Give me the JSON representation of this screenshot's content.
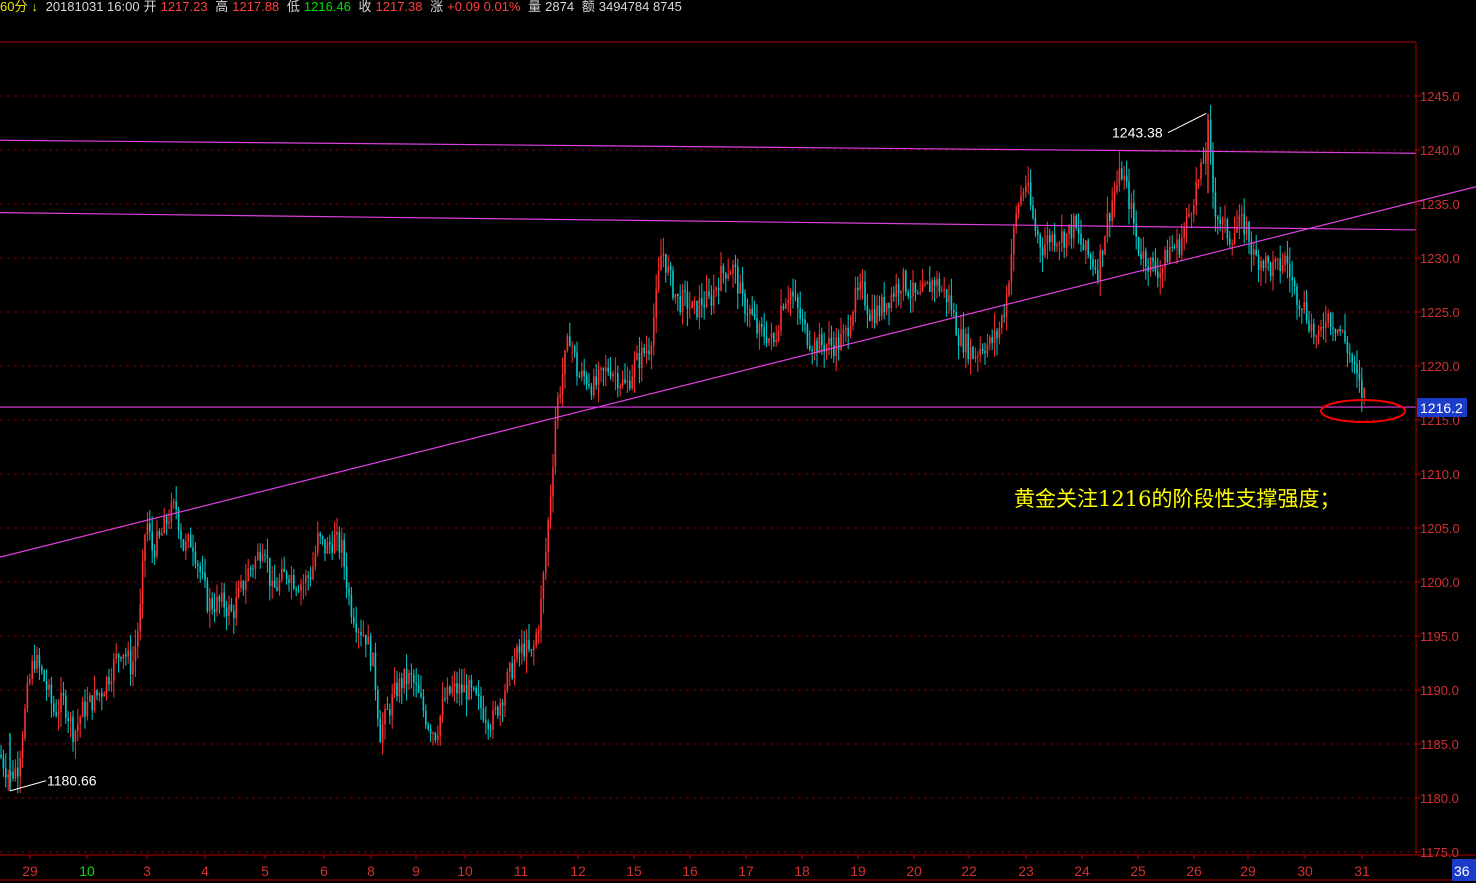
{
  "header": {
    "period": "60分",
    "arrow": "↓",
    "date_time": "20181031 16:00",
    "open_label": "开",
    "open": "1217.23",
    "high_label": "高",
    "high": "1217.88",
    "low_label": "低",
    "low": "1216.46",
    "close_label": "收",
    "close": "1217.38",
    "change_label": "涨",
    "change": "+0.09 0.01%",
    "volume_label": "量",
    "volume": "2874",
    "amount_label": "额",
    "amount": "3494784 8745"
  },
  "colors": {
    "background": "#000000",
    "up": "#ff3030",
    "down": "#00cccc",
    "frame": "#b00000",
    "grid": "#7a0000",
    "trendline": "#e040e0",
    "annotation": "#ffff00",
    "price_tag_bg": "#1a3cc8",
    "highlight_circle": "#ff0000"
  },
  "chart_data": {
    "type": "candlestick",
    "ylim": [
      1175,
      1247
    ],
    "y_ticks": [
      "1245.0",
      "1240.0",
      "1235.0",
      "1230.0",
      "1225.0",
      "1220.0",
      "1215.0",
      "1210.0",
      "1205.0",
      "1200.0",
      "1195.0",
      "1190.0",
      "1185.0",
      "1180.0",
      "1175.0"
    ],
    "x_tick_labels": [
      "29",
      "10",
      "3",
      "4",
      "5",
      "6",
      "8",
      "9",
      "10",
      "11",
      "12",
      "15",
      "16",
      "17",
      "18",
      "19",
      "20",
      "22",
      "23",
      "24",
      "25",
      "26",
      "29",
      "30",
      "31"
    ],
    "x_tick_colors": [
      "red",
      "green",
      "red",
      "red",
      "red",
      "red",
      "red",
      "red",
      "red",
      "red",
      "red",
      "red",
      "red",
      "red",
      "red",
      "red",
      "red",
      "red",
      "red",
      "red",
      "red",
      "red",
      "red",
      "red",
      "red"
    ],
    "x_corner_label": "36",
    "current_price": "1216.2",
    "max_label": "1243.38",
    "min_label": "1180.66",
    "annotation": "黄金关注1216的阶段性支撑强度；",
    "max_value": 1243.38,
    "min_value": 1180.66,
    "support_value": 1216.2,
    "lines": [
      {
        "name": "upper-resistance-line",
        "from": [
          0,
          1240.9
        ],
        "to": [
          1416,
          1239.7
        ]
      },
      {
        "name": "middle-resistance-line",
        "from": [
          0,
          1234.2
        ],
        "to": [
          1416,
          1232.6
        ]
      },
      {
        "name": "rising-trendline",
        "from": [
          0,
          1202.3
        ],
        "to": [
          1476,
          1236.6
        ]
      },
      {
        "name": "support-line",
        "from": [
          0,
          1216.2
        ],
        "to": [
          1416,
          1216.2
        ]
      }
    ],
    "anchors": [
      [
        0,
        1184
      ],
      [
        10,
        1182
      ],
      [
        18,
        1183
      ],
      [
        28,
        1190
      ],
      [
        34,
        1193
      ],
      [
        44,
        1191
      ],
      [
        54,
        1188
      ],
      [
        64,
        1189
      ],
      [
        74,
        1186
      ],
      [
        82,
        1188
      ],
      [
        92,
        1189
      ],
      [
        102,
        1190
      ],
      [
        112,
        1192
      ],
      [
        122,
        1194
      ],
      [
        132,
        1192
      ],
      [
        140,
        1197
      ],
      [
        146,
        1206
      ],
      [
        152,
        1203
      ],
      [
        160,
        1204
      ],
      [
        168,
        1206
      ],
      [
        176,
        1207
      ],
      [
        184,
        1203
      ],
      [
        192,
        1204
      ],
      [
        200,
        1201
      ],
      [
        208,
        1198
      ],
      [
        216,
        1198
      ],
      [
        224,
        1198
      ],
      [
        232,
        1197
      ],
      [
        240,
        1199
      ],
      [
        248,
        1201
      ],
      [
        256,
        1202
      ],
      [
        264,
        1204
      ],
      [
        272,
        1199
      ],
      [
        280,
        1200
      ],
      [
        288,
        1201
      ],
      [
        296,
        1200
      ],
      [
        304,
        1200
      ],
      [
        312,
        1201
      ],
      [
        318,
        1204
      ],
      [
        326,
        1203
      ],
      [
        334,
        1204
      ],
      [
        342,
        1203
      ],
      [
        350,
        1198
      ],
      [
        358,
        1196
      ],
      [
        366,
        1195
      ],
      [
        374,
        1192
      ],
      [
        380,
        1186
      ],
      [
        388,
        1188
      ],
      [
        396,
        1190
      ],
      [
        404,
        1191
      ],
      [
        412,
        1191
      ],
      [
        420,
        1189
      ],
      [
        428,
        1187
      ],
      [
        436,
        1186
      ],
      [
        444,
        1189
      ],
      [
        452,
        1190
      ],
      [
        460,
        1190
      ],
      [
        468,
        1190
      ],
      [
        476,
        1189
      ],
      [
        484,
        1188
      ],
      [
        492,
        1187
      ],
      [
        500,
        1189
      ],
      [
        508,
        1191
      ],
      [
        516,
        1193
      ],
      [
        524,
        1194
      ],
      [
        532,
        1193
      ],
      [
        540,
        1197
      ],
      [
        546,
        1203
      ],
      [
        552,
        1210
      ],
      [
        556,
        1216
      ],
      [
        562,
        1219
      ],
      [
        570,
        1223
      ],
      [
        578,
        1219
      ],
      [
        586,
        1219
      ],
      [
        594,
        1218
      ],
      [
        602,
        1219
      ],
      [
        610,
        1220
      ],
      [
        618,
        1219
      ],
      [
        626,
        1218
      ],
      [
        634,
        1220
      ],
      [
        642,
        1221
      ],
      [
        650,
        1222
      ],
      [
        656,
        1226
      ],
      [
        662,
        1231
      ],
      [
        670,
        1228
      ],
      [
        678,
        1226
      ],
      [
        686,
        1226
      ],
      [
        694,
        1225
      ],
      [
        702,
        1226
      ],
      [
        710,
        1226
      ],
      [
        718,
        1228
      ],
      [
        726,
        1229
      ],
      [
        734,
        1229
      ],
      [
        742,
        1226
      ],
      [
        750,
        1225
      ],
      [
        758,
        1223
      ],
      [
        766,
        1223
      ],
      [
        774,
        1222
      ],
      [
        782,
        1226
      ],
      [
        790,
        1227
      ],
      [
        798,
        1225
      ],
      [
        806,
        1223
      ],
      [
        814,
        1222
      ],
      [
        822,
        1222
      ],
      [
        830,
        1222
      ],
      [
        838,
        1222
      ],
      [
        846,
        1223
      ],
      [
        854,
        1226
      ],
      [
        862,
        1227
      ],
      [
        870,
        1225
      ],
      [
        878,
        1225
      ],
      [
        886,
        1226
      ],
      [
        894,
        1227
      ],
      [
        902,
        1228
      ],
      [
        910,
        1227
      ],
      [
        918,
        1226
      ],
      [
        926,
        1227
      ],
      [
        934,
        1228
      ],
      [
        942,
        1227
      ],
      [
        950,
        1226
      ],
      [
        958,
        1223
      ],
      [
        966,
        1222
      ],
      [
        974,
        1221
      ],
      [
        982,
        1222
      ],
      [
        990,
        1222
      ],
      [
        998,
        1223
      ],
      [
        1006,
        1226
      ],
      [
        1012,
        1231
      ],
      [
        1018,
        1235
      ],
      [
        1026,
        1237
      ],
      [
        1034,
        1233
      ],
      [
        1042,
        1231
      ],
      [
        1050,
        1232
      ],
      [
        1058,
        1232
      ],
      [
        1066,
        1232
      ],
      [
        1074,
        1233
      ],
      [
        1082,
        1231
      ],
      [
        1090,
        1230
      ],
      [
        1098,
        1229
      ],
      [
        1106,
        1233
      ],
      [
        1114,
        1236
      ],
      [
        1122,
        1238
      ],
      [
        1130,
        1235
      ],
      [
        1138,
        1231
      ],
      [
        1146,
        1230
      ],
      [
        1154,
        1229
      ],
      [
        1162,
        1229
      ],
      [
        1170,
        1231
      ],
      [
        1178,
        1231
      ],
      [
        1186,
        1233
      ],
      [
        1194,
        1236
      ],
      [
        1202,
        1238
      ],
      [
        1208,
        1242
      ],
      [
        1214,
        1235
      ],
      [
        1222,
        1233
      ],
      [
        1230,
        1232
      ],
      [
        1238,
        1233
      ],
      [
        1246,
        1233
      ],
      [
        1254,
        1230
      ],
      [
        1262,
        1230
      ],
      [
        1270,
        1229
      ],
      [
        1278,
        1229
      ],
      [
        1286,
        1230
      ],
      [
        1294,
        1227
      ],
      [
        1302,
        1226
      ],
      [
        1310,
        1224
      ],
      [
        1318,
        1222
      ],
      [
        1326,
        1225
      ],
      [
        1334,
        1224
      ],
      [
        1342,
        1223
      ],
      [
        1350,
        1221
      ],
      [
        1356,
        1219
      ],
      [
        1362,
        1217.4
      ],
      [
        1366,
        1217.4
      ]
    ],
    "bars_per_day": 4
  }
}
